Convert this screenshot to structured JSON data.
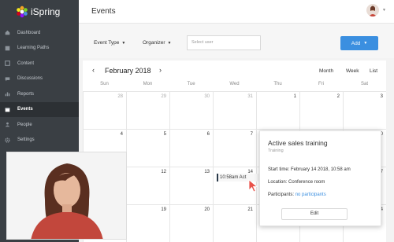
{
  "app": {
    "name": "iSpring",
    "page_title": "Events",
    "accent": "#3b8fe0"
  },
  "sidebar": {
    "items": [
      {
        "label": "Dashboard",
        "icon": "home-icon"
      },
      {
        "label": "Learning Paths",
        "icon": "learning-paths-icon"
      },
      {
        "label": "Content",
        "icon": "content-icon"
      },
      {
        "label": "Discussions",
        "icon": "discussions-icon"
      },
      {
        "label": "Reports",
        "icon": "reports-icon"
      },
      {
        "label": "Events",
        "icon": "events-icon",
        "active": true
      },
      {
        "label": "People",
        "icon": "people-icon"
      },
      {
        "label": "Settings",
        "icon": "settings-icon"
      }
    ]
  },
  "filters": {
    "event_type": "Event Type",
    "organizer": "Organizer",
    "select_user_placeholder": "Select user",
    "add_label": "Add"
  },
  "calendar": {
    "month_label": "February 2018",
    "views": [
      "Month",
      "Week",
      "List"
    ],
    "weekdays": [
      "Sun",
      "Mon",
      "Tue",
      "Wed",
      "Thu",
      "Fri",
      "Sat"
    ],
    "weeks": [
      [
        "28",
        "29",
        "30",
        "31",
        "1",
        "2",
        "3"
      ],
      [
        "4",
        "5",
        "6",
        "7",
        "8",
        "9",
        "10"
      ],
      [
        "11",
        "12",
        "13",
        "14",
        "15",
        "16",
        "17"
      ],
      [
        "18",
        "19",
        "20",
        "21",
        "22",
        "23",
        "24"
      ]
    ],
    "event_chip": "10:58am Act"
  },
  "popup": {
    "title": "Active sales training",
    "subtitle": "Training",
    "start_time": "Start time: February 14 2018, 10:58 am",
    "location": "Location: Conference room",
    "participants_label": "Participants: ",
    "participants_value": "no participants",
    "edit_label": "Edit"
  }
}
